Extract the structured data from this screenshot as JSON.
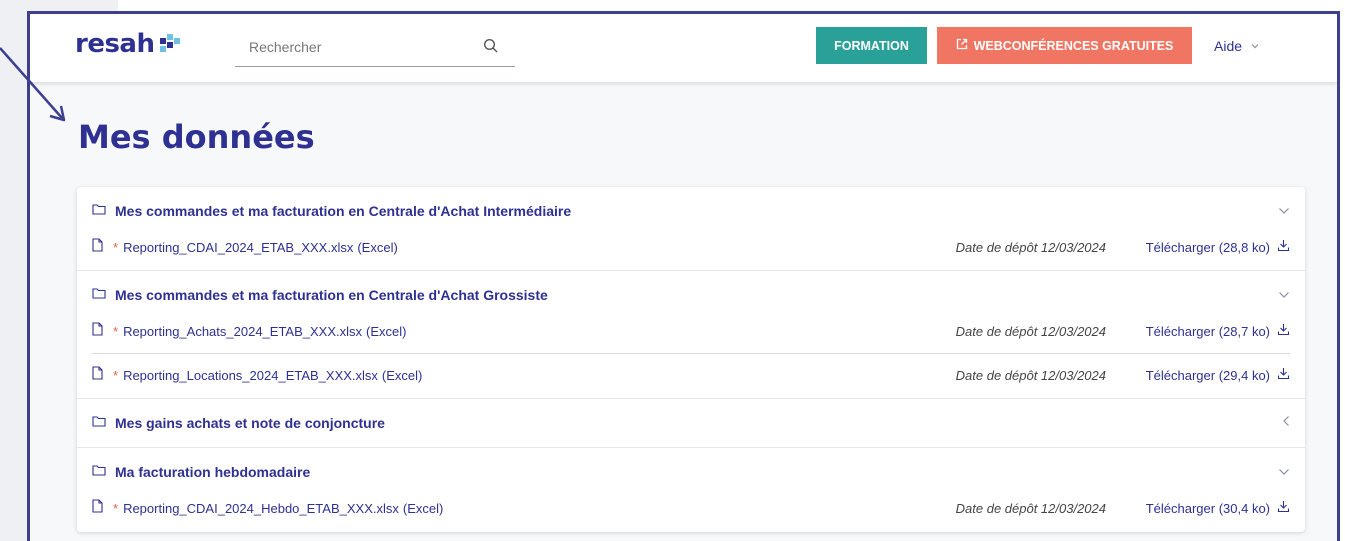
{
  "header": {
    "logo_text": "resah",
    "search_placeholder": "Rechercher",
    "formation_label": "FORMATION",
    "webconf_label": "WEBCONFÉRENCES GRATUITES",
    "aide_label": "Aide"
  },
  "page": {
    "title": "Mes données"
  },
  "sections": [
    {
      "title": "Mes commandes et ma facturation en Centrale d'Achat Intermédiaire",
      "state": "expanded",
      "files": [
        {
          "marker": "*",
          "name": "Reporting_CDAI_2024_ETAB_XXX.xlsx",
          "type": "(Excel)",
          "date": "Date de dépôt 12/03/2024",
          "download": "Télécharger (28,8 ko)"
        }
      ]
    },
    {
      "title": "Mes commandes et ma facturation en Centrale d'Achat Grossiste",
      "state": "expanded",
      "files": [
        {
          "marker": "*",
          "name": "Reporting_Achats_2024_ETAB_XXX.xlsx",
          "type": "(Excel)",
          "date": "Date de dépôt 12/03/2024",
          "download": "Télécharger (28,7 ko)"
        },
        {
          "marker": "*",
          "name": "Reporting_Locations_2024_ETAB_XXX.xlsx",
          "type": "(Excel)",
          "date": "Date de dépôt 12/03/2024",
          "download": "Télécharger (29,4 ko)"
        }
      ]
    },
    {
      "title": "Mes gains achats et note de conjoncture",
      "state": "collapsed",
      "files": []
    },
    {
      "title": "Ma facturation hebdomadaire",
      "state": "expanded",
      "files": [
        {
          "marker": "*",
          "name": "Reporting_CDAI_2024_Hebdo_ETAB_XXX.xlsx",
          "type": "(Excel)",
          "date": "Date de dépôt 12/03/2024",
          "download": "Télécharger (30,4 ko)"
        }
      ]
    }
  ],
  "colors": {
    "brand": "#2e3192",
    "formation": "#2aa198",
    "webconf": "#f07562",
    "required_marker": "#e85d4a"
  },
  "icons": {
    "section": "folder-icon",
    "file": "file-icon",
    "download": "download-icon",
    "expanded": "chevron-down-icon",
    "collapsed": "chevron-left-icon",
    "search": "search-icon",
    "external": "external-link-icon"
  }
}
